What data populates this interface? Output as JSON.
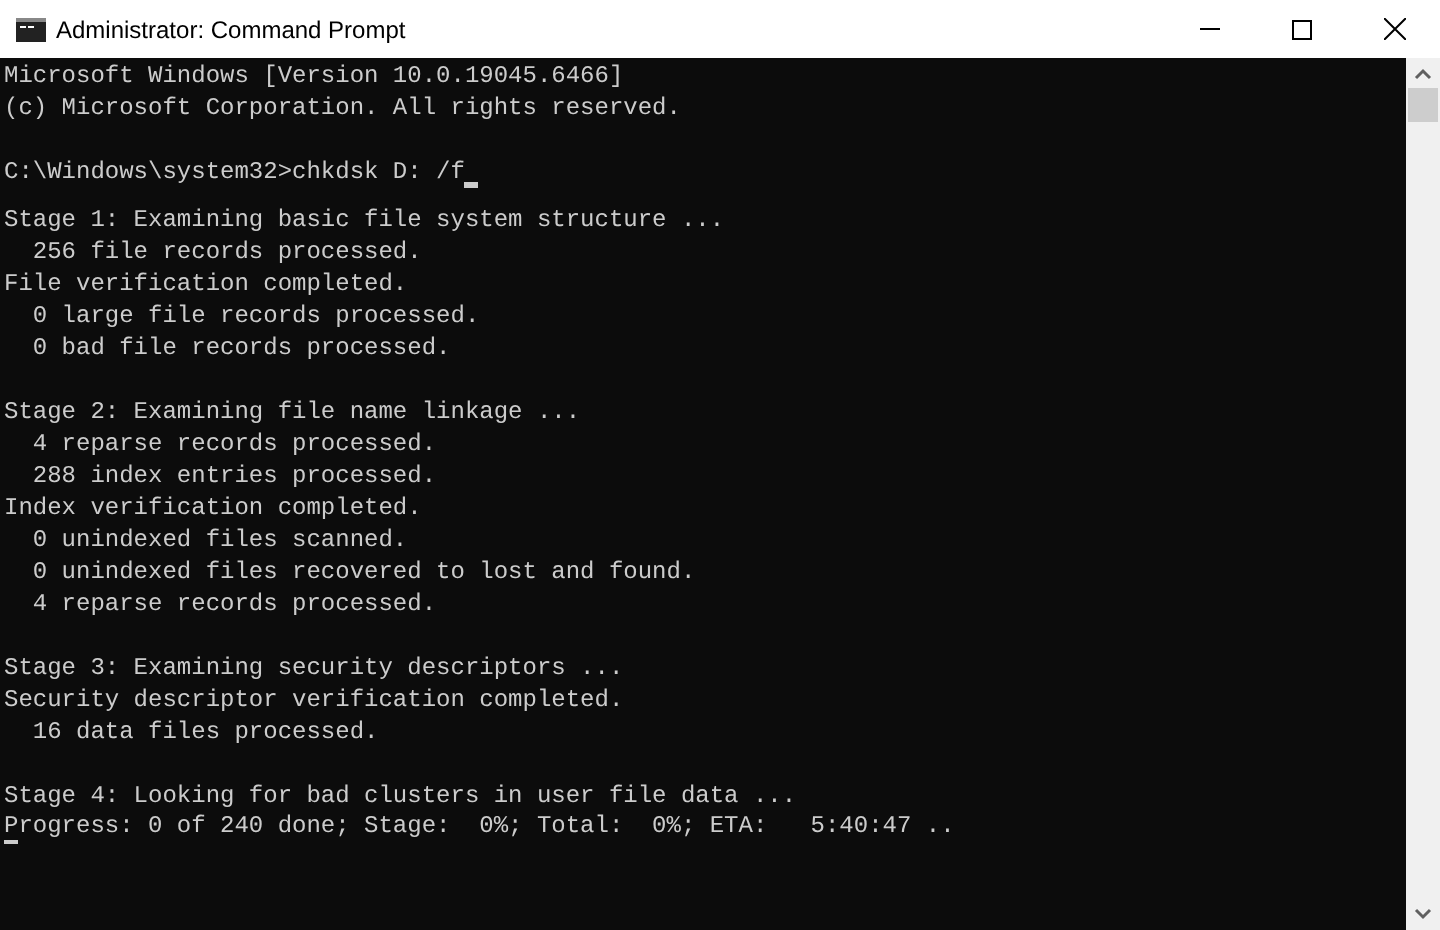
{
  "window": {
    "title": "Administrator: Command Prompt"
  },
  "console": {
    "blocks": [
      {
        "lines": [
          {
            "kind": "output",
            "text": "Microsoft Windows [Version 10.0.19045.6466]"
          },
          {
            "kind": "output",
            "text": "(c) Microsoft Corporation. All rights reserved."
          }
        ]
      },
      {
        "lines": [
          {
            "kind": "input",
            "text": "C:\\Windows\\system32>chkdsk D: /f"
          }
        ]
      },
      {
        "lines": [
          {
            "kind": "output",
            "text": "Stage 1: Examining basic file system structure ..."
          },
          {
            "kind": "output",
            "text": "  256 file records processed."
          },
          {
            "kind": "output",
            "text": "File verification completed."
          },
          {
            "kind": "output",
            "text": "  0 large file records processed."
          },
          {
            "kind": "output",
            "text": "  0 bad file records processed."
          }
        ]
      },
      {
        "lines": [
          {
            "kind": "output",
            "text": "Stage 2: Examining file name linkage ..."
          },
          {
            "kind": "output",
            "text": "  4 reparse records processed."
          },
          {
            "kind": "output",
            "text": "  288 index entries processed."
          },
          {
            "kind": "output",
            "text": "Index verification completed."
          },
          {
            "kind": "output",
            "text": "  0 unindexed files scanned."
          },
          {
            "kind": "output",
            "text": "  0 unindexed files recovered to lost and found."
          },
          {
            "kind": "output",
            "text": "  4 reparse records processed."
          }
        ]
      },
      {
        "lines": [
          {
            "kind": "output",
            "text": "Stage 3: Examining security descriptors ..."
          },
          {
            "kind": "output",
            "text": "Security descriptor verification completed."
          },
          {
            "kind": "output",
            "text": "  16 data files processed."
          }
        ]
      },
      {
        "lines": [
          {
            "kind": "output",
            "text": "Stage 4: Looking for bad clusters in user file data ..."
          },
          {
            "kind": "progress",
            "text": "Progress: 0 of 240 done; Stage:  0%; Total:  0%; ETA:   5:40:47 .."
          }
        ]
      }
    ]
  }
}
